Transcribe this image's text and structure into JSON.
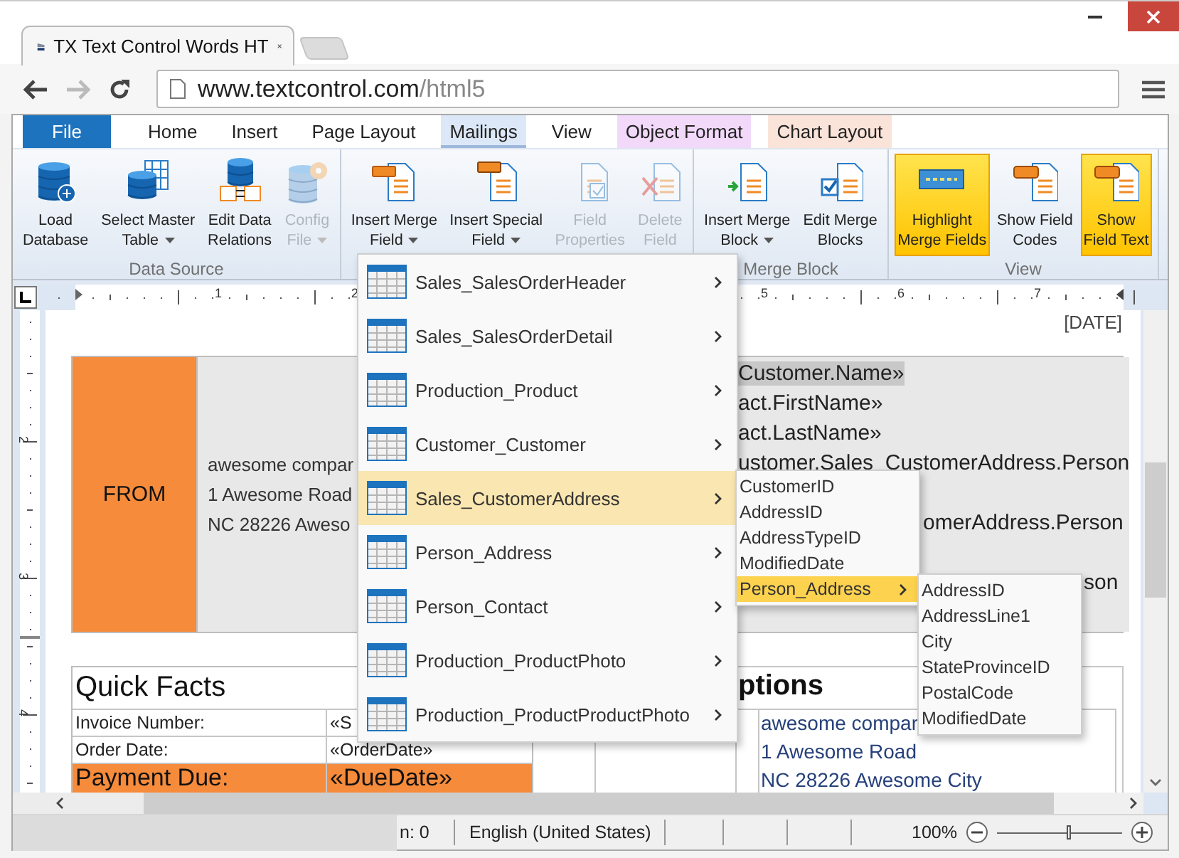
{
  "browser": {
    "tab_title": "TX Text Control Words HT",
    "url": "www.textcontrol.com/html5"
  },
  "ribbon_tabs": [
    {
      "label": "File",
      "kind": "file",
      "selected": false
    },
    {
      "label": "Home",
      "kind": "tab",
      "selected": false
    },
    {
      "label": "Insert",
      "kind": "tab",
      "selected": false
    },
    {
      "label": "Page Layout",
      "kind": "tab",
      "selected": false
    },
    {
      "label": "Mailings",
      "kind": "tab",
      "selected": true
    },
    {
      "label": "View",
      "kind": "tab",
      "selected": false
    },
    {
      "label": "Object Format",
      "kind": "context",
      "selected": false,
      "color": "#f2d9fa"
    },
    {
      "label": "Chart Layout",
      "kind": "context",
      "selected": false,
      "color": "#fae3d9"
    }
  ],
  "ribbon_groups": [
    {
      "label": "Data Source",
      "buttons": [
        {
          "lines": [
            "Load",
            "Database"
          ],
          "kind": "database-add",
          "dropdown": false,
          "disabled": false,
          "active": false
        },
        {
          "lines": [
            "Select Master",
            "Table"
          ],
          "kind": "database-table",
          "dropdown": true,
          "disabled": false,
          "active": false
        },
        {
          "lines": [
            "Edit Data",
            "Relations"
          ],
          "kind": "database-relations",
          "dropdown": false,
          "disabled": false,
          "active": false
        },
        {
          "lines": [
            "Config",
            "File"
          ],
          "kind": "database-gear",
          "dropdown": true,
          "disabled": true,
          "active": false
        }
      ]
    },
    {
      "buttons": [
        {
          "lines": [
            "Insert Merge",
            "Field"
          ],
          "kind": "field-insert",
          "dropdown": true,
          "disabled": false,
          "active": false
        },
        {
          "lines": [
            "Insert Special",
            "Field"
          ],
          "kind": "field-special",
          "dropdown": true,
          "disabled": false,
          "active": false
        },
        {
          "lines": [
            "Field",
            "Properties"
          ],
          "kind": "field-properties",
          "dropdown": false,
          "disabled": true,
          "active": false
        },
        {
          "lines": [
            "Delete",
            "Field"
          ],
          "kind": "field-delete",
          "dropdown": false,
          "disabled": true,
          "active": false
        }
      ]
    },
    {
      "label": "Merge Block",
      "buttons": [
        {
          "lines": [
            "Insert Merge",
            "Block"
          ],
          "kind": "block-insert",
          "dropdown": true,
          "disabled": false,
          "active": false
        },
        {
          "lines": [
            "Edit Merge",
            "Blocks"
          ],
          "kind": "block-edit",
          "dropdown": false,
          "disabled": false,
          "active": false
        }
      ]
    },
    {
      "label": "View",
      "buttons": [
        {
          "lines": [
            "Highlight",
            "Merge Fields"
          ],
          "kind": "highlight",
          "dropdown": false,
          "disabled": false,
          "active": true
        },
        {
          "lines": [
            "Show Field",
            "Codes"
          ],
          "kind": "field-codes",
          "dropdown": false,
          "disabled": false,
          "active": false
        },
        {
          "lines": [
            "Show",
            "Field Text"
          ],
          "kind": "field-text",
          "dropdown": false,
          "disabled": false,
          "active": true
        }
      ]
    }
  ],
  "ruler": {
    "numbers": [
      "1",
      "2",
      "5",
      "6",
      "7"
    ],
    "vertical_numbers": [
      "2",
      "3",
      "4"
    ]
  },
  "document": {
    "date_field": "[DATE]",
    "from_label": "FROM",
    "sender_lines": [
      "awesome compar",
      "1 Awesome Road",
      "NC 28226 Aweso"
    ],
    "merge_lines": [
      {
        "text": "Customer.Name»",
        "selected": true
      },
      {
        "text": "act.FirstName»",
        "selected": false
      },
      {
        "text": "act.LastName»",
        "selected": false
      },
      {
        "text": "ustomer.Sales_CustomerAddress.Person",
        "selected": false
      },
      {
        "text": "omerAddress.Person",
        "selected": false
      },
      {
        "text": "son",
        "selected": false
      }
    ],
    "quick_facts": {
      "title": "Quick Facts",
      "rows": [
        {
          "label": "Invoice Number:",
          "value": "«S",
          "kind": "normal"
        },
        {
          "label": "Order Date:",
          "value": "«OrderDate»",
          "kind": "normal"
        },
        {
          "label": "Payment Due:",
          "value": "«DueDate»",
          "kind": "due"
        }
      ]
    },
    "options": {
      "title": "ptions",
      "lines": [
        "awesome compar",
        "1 Awesome Road",
        "NC 28226 Awesome City"
      ]
    }
  },
  "field_menu": {
    "items": [
      {
        "label": "Sales_SalesOrderHeader",
        "selected": false
      },
      {
        "label": "Sales_SalesOrderDetail",
        "selected": false
      },
      {
        "label": "Production_Product",
        "selected": false
      },
      {
        "label": "Customer_Customer",
        "selected": false
      },
      {
        "label": "Sales_CustomerAddress",
        "selected": true
      },
      {
        "label": "Person_Address",
        "selected": false
      },
      {
        "label": "Person_Contact",
        "selected": false
      },
      {
        "label": "Production_ProductPhoto",
        "selected": false
      },
      {
        "label": "Production_ProductProductPhoto",
        "selected": false
      }
    ]
  },
  "submenu": {
    "items": [
      {
        "label": "CustomerID",
        "kind": "field",
        "selected": false
      },
      {
        "label": "AddressID",
        "kind": "field",
        "selected": false
      },
      {
        "label": "AddressTypeID",
        "kind": "field",
        "selected": false
      },
      {
        "label": "ModifiedDate",
        "kind": "field",
        "selected": false
      },
      {
        "label": "Person_Address",
        "kind": "table",
        "selected": true
      }
    ]
  },
  "submenu_2": {
    "items": [
      {
        "label": "AddressID",
        "selected": false
      },
      {
        "label": "AddressLine1",
        "selected": false
      },
      {
        "label": "City",
        "selected": false
      },
      {
        "label": "StateProvinceID",
        "selected": false
      },
      {
        "label": "PostalCode",
        "selected": false
      },
      {
        "label": "ModifiedDate",
        "selected": false
      }
    ]
  },
  "status_bar": {
    "column": "n: 0",
    "language": "English (United States)",
    "zoom": "100%",
    "zoom_slider": {
      "level": 0.57
    }
  }
}
